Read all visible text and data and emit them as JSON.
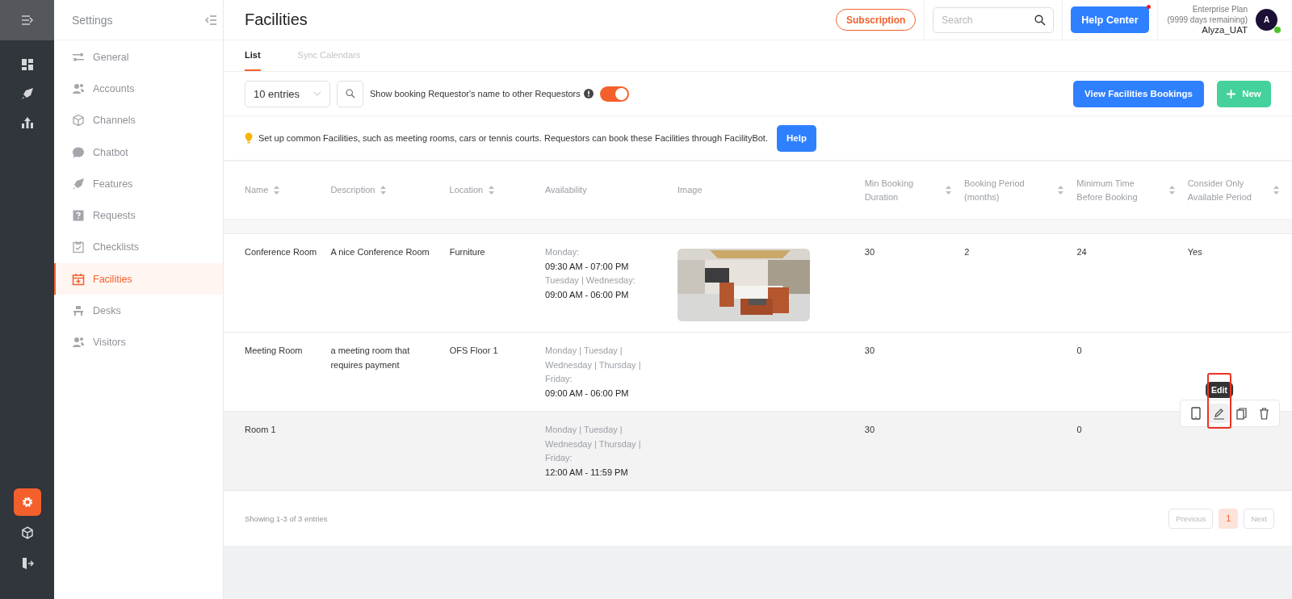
{
  "rail": {
    "top": [
      {
        "kind": "menu"
      }
    ],
    "items": [
      {
        "kind": "dashboard",
        "selected": false
      },
      {
        "kind": "rocket",
        "selected": false
      },
      {
        "kind": "chart",
        "selected": false
      }
    ],
    "bottom": [
      {
        "kind": "gear",
        "selected": true
      },
      {
        "kind": "cube",
        "selected": false
      },
      {
        "kind": "exit",
        "selected": false
      }
    ]
  },
  "sidebar": {
    "title": "Settings",
    "items": [
      {
        "label": "General",
        "kind": "sliders",
        "selected": false
      },
      {
        "label": "Accounts",
        "kind": "users",
        "selected": false
      },
      {
        "label": "Channels",
        "kind": "cube",
        "selected": false
      },
      {
        "label": "Chatbot",
        "kind": "chat",
        "selected": false
      },
      {
        "label": "Features",
        "kind": "rocket",
        "selected": false
      },
      {
        "label": "Requests",
        "kind": "question",
        "selected": false
      },
      {
        "label": "Checklists",
        "kind": "checklist",
        "selected": false
      },
      {
        "label": "Facilities",
        "kind": "calendar",
        "selected": true
      },
      {
        "label": "Desks",
        "kind": "desk",
        "selected": false
      },
      {
        "label": "Visitors",
        "kind": "users",
        "selected": false
      }
    ]
  },
  "header": {
    "title": "Facilities",
    "subscription": "Subscription",
    "search": {
      "placeholder": "Search"
    },
    "help_center": {
      "label": "Help Center",
      "notification": true
    },
    "plan": "Enterprise Plan",
    "days": "(9999 days remaining)",
    "user": "Alyza_UAT",
    "avatar": "A",
    "online": true
  },
  "tabs": [
    {
      "label": "List",
      "selected": true
    },
    {
      "label": "Sync Calendars",
      "selected": false
    }
  ],
  "toolbar": {
    "entries": "10 entries",
    "toggle_label": "Show booking Requestor's name to other Requestors",
    "toggle_on": true,
    "view_bookings": "View Facilities Bookings",
    "new": "New"
  },
  "info": {
    "text": "Set up common Facilities, such as meeting rooms, cars or tennis courts. Requestors can book these Facilities through FacilityBot.",
    "button": "Help"
  },
  "table": {
    "columns": [
      {
        "label": "Name",
        "sortable": true
      },
      {
        "label": "Description",
        "sortable": true
      },
      {
        "label": "Location",
        "sortable": true
      },
      {
        "label": "Availability",
        "sortable": false
      },
      {
        "label": "Image",
        "sortable": false
      },
      {
        "label": "Min Booking Duration",
        "sortable": true
      },
      {
        "label": "Booking Period (months)",
        "sortable": true
      },
      {
        "label": "Minimum Time Before Booking",
        "sortable": true
      },
      {
        "label": "Consider Only Available Period",
        "sortable": true
      }
    ],
    "rows": [
      {
        "name": "Conference Room",
        "description": "A nice Conference Room",
        "location": "Furniture",
        "availability": [
          {
            "days": "Monday:",
            "hours": "09:30 AM - 07:00 PM"
          },
          {
            "days": "Tuesday | Wednesday:",
            "hours": "09:00 AM - 06:00 PM"
          }
        ],
        "image": {
          "kind": "picture"
        },
        "min_duration": "30",
        "booking_period": "2",
        "min_time": "24",
        "consider_only": "Yes",
        "hovered": false
      },
      {
        "name": "Meeting Room",
        "description": "a meeting room that requires payment",
        "location": "OFS Floor 1",
        "availability": [
          {
            "days": "Monday | Tuesday | Wednesday | Thursday | Friday:",
            "hours": "09:00 AM - 06:00 PM"
          }
        ],
        "min_duration": "30",
        "min_time": "0",
        "hovered": false
      },
      {
        "name": "Room 1",
        "availability": [
          {
            "days": "Monday | Tuesday | Wednesday | Thursday | Friday:",
            "hours": "12:00 AM - 11:59 PM"
          }
        ],
        "min_duration": "30",
        "min_time": "0",
        "hovered": true
      }
    ]
  },
  "row_actions": {
    "tooltip": "Edit",
    "items": [
      {
        "kind": "view",
        "highlighted": false
      },
      {
        "kind": "edit",
        "highlighted": true
      },
      {
        "kind": "copy",
        "highlighted": false
      },
      {
        "kind": "delete",
        "highlighted": false
      }
    ]
  },
  "footer": {
    "summary": "Showing 1-3 of 3 entries",
    "pages": [
      {
        "label": "Previous",
        "selected": false
      },
      {
        "label": "1",
        "selected": true
      },
      {
        "label": "Next",
        "selected": false
      }
    ]
  }
}
